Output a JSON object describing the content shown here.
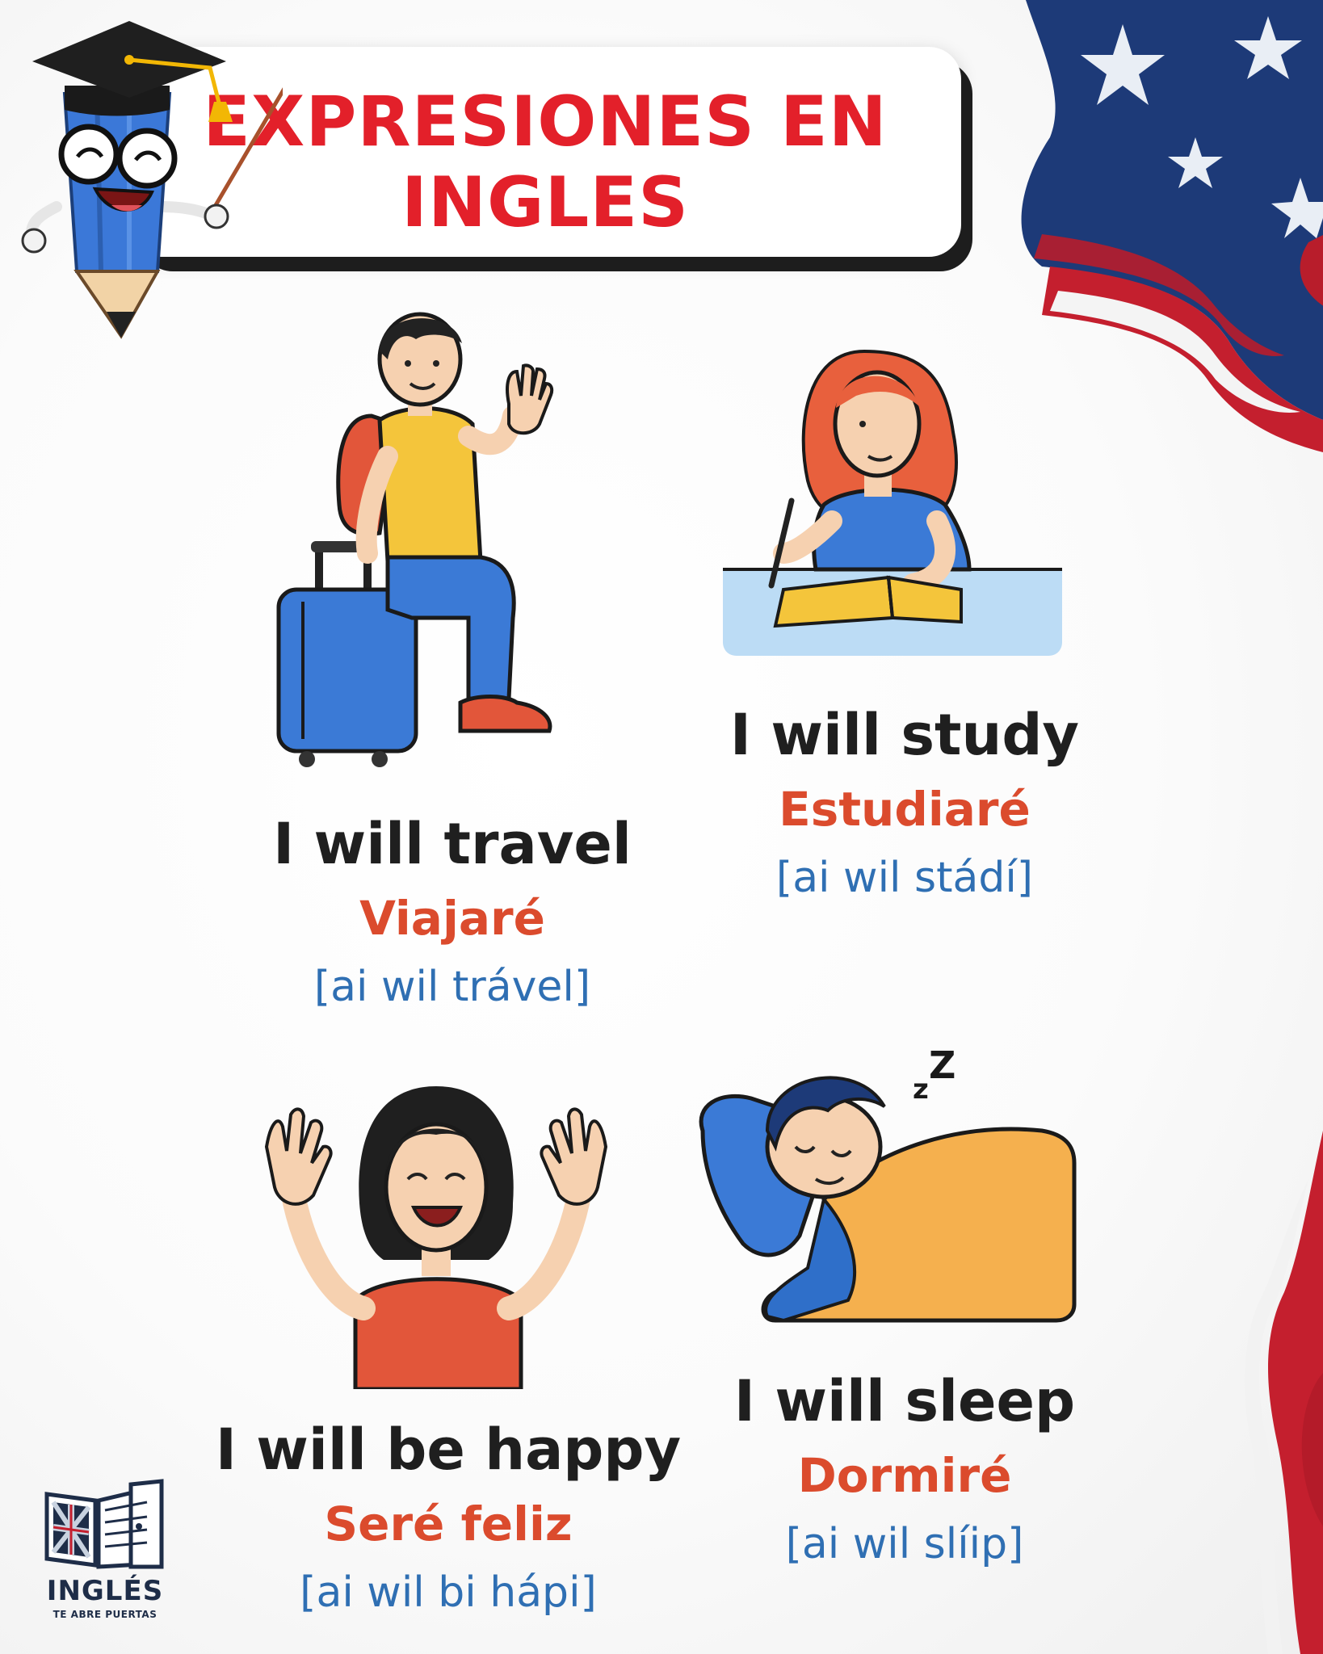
{
  "title": {
    "line1": "EXPRESIONES EN",
    "line2": "INGLES"
  },
  "cards": [
    {
      "icon": "traveler-icon",
      "english": "I will travel",
      "spanish": "Viajaré",
      "pronunciation": "[ai wil trável]"
    },
    {
      "icon": "student-icon",
      "english": "I will study",
      "spanish": "Estudiaré",
      "pronunciation": "[ai wil stádí]"
    },
    {
      "icon": "happy-person-icon",
      "english": "I will be happy",
      "spanish": "Seré feliz",
      "pronunciation": "[ai wil bi hápi]"
    },
    {
      "icon": "sleeping-person-icon",
      "english": "I will sleep",
      "spanish": "Dormiré",
      "pronunciation": "[ai wil slíip]"
    }
  ],
  "logo": {
    "name": "INGLÉS",
    "tagline": "TE ABRE PUERTAS"
  },
  "colors": {
    "title": "#e3202a",
    "english": "#1f1f1f",
    "spanish": "#db4b2d",
    "pronunciation": "#2f6fb3",
    "logo": "#1e2d48"
  }
}
